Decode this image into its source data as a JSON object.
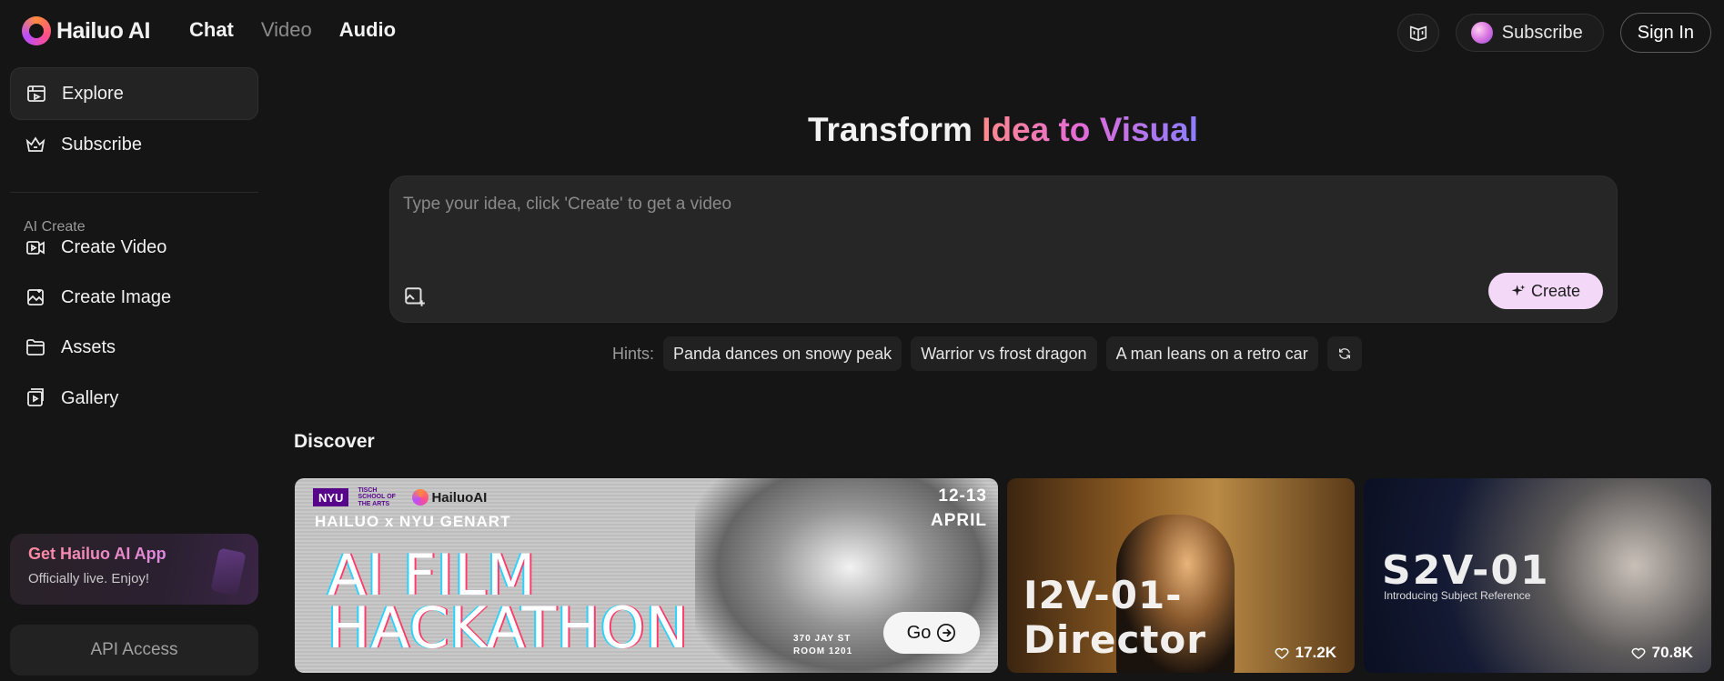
{
  "header": {
    "logo_text": "Hailuo AI",
    "nav": [
      "Chat",
      "Video",
      "Audio"
    ],
    "subscribe_label": "Subscribe",
    "signin_label": "Sign In"
  },
  "sidebar": {
    "items": [
      {
        "label": "Explore",
        "icon": "explore-icon"
      },
      {
        "label": "Subscribe",
        "icon": "crown-icon"
      }
    ],
    "section_heading": "AI Create",
    "create_items": [
      {
        "label": "Create Video",
        "icon": "video-icon"
      },
      {
        "label": "Create Image",
        "icon": "image-icon"
      },
      {
        "label": "Assets",
        "icon": "folder-icon"
      },
      {
        "label": "Gallery",
        "icon": "gallery-icon"
      }
    ],
    "app_card": {
      "title": "Get Hailuo AI App",
      "subtitle": "Officially live. Enjoy!"
    },
    "api_label": "API Access"
  },
  "main": {
    "title_plain": "Transform ",
    "title_gradient": "Idea to Visual",
    "prompt_placeholder": "Type your idea, click 'Create' to get a video",
    "create_label": "Create",
    "hints_label": "Hints:",
    "hints": [
      "Panda dances on snowy peak",
      "Warrior vs frost dragon",
      "A man leans on a retro car"
    ]
  },
  "discover": {
    "heading": "Discover",
    "banner": {
      "logos": [
        "NYU",
        "TISCH SCHOOL OF THE ARTS",
        "HailuoAI"
      ],
      "line": "HAILUO x NYU GENART",
      "date_line1": "12-13",
      "date_line2": "APRIL",
      "big_line1": "AI FILM",
      "big_line2": "HACKATHON",
      "addr_line1": "370 JAY ST",
      "addr_line2": "ROOM 1201",
      "go_label": "Go"
    },
    "cards": [
      {
        "title": "I2V-01-Director",
        "likes": "17.2K"
      },
      {
        "title": "S2V-01",
        "subtitle": "Introducing Subject Reference",
        "likes": "70.8K"
      }
    ]
  },
  "colors": {
    "accent_pink": "#ff8a8a",
    "accent_purple": "#8b7dff",
    "create_bg": "#f3d8f7",
    "background": "#151515"
  }
}
